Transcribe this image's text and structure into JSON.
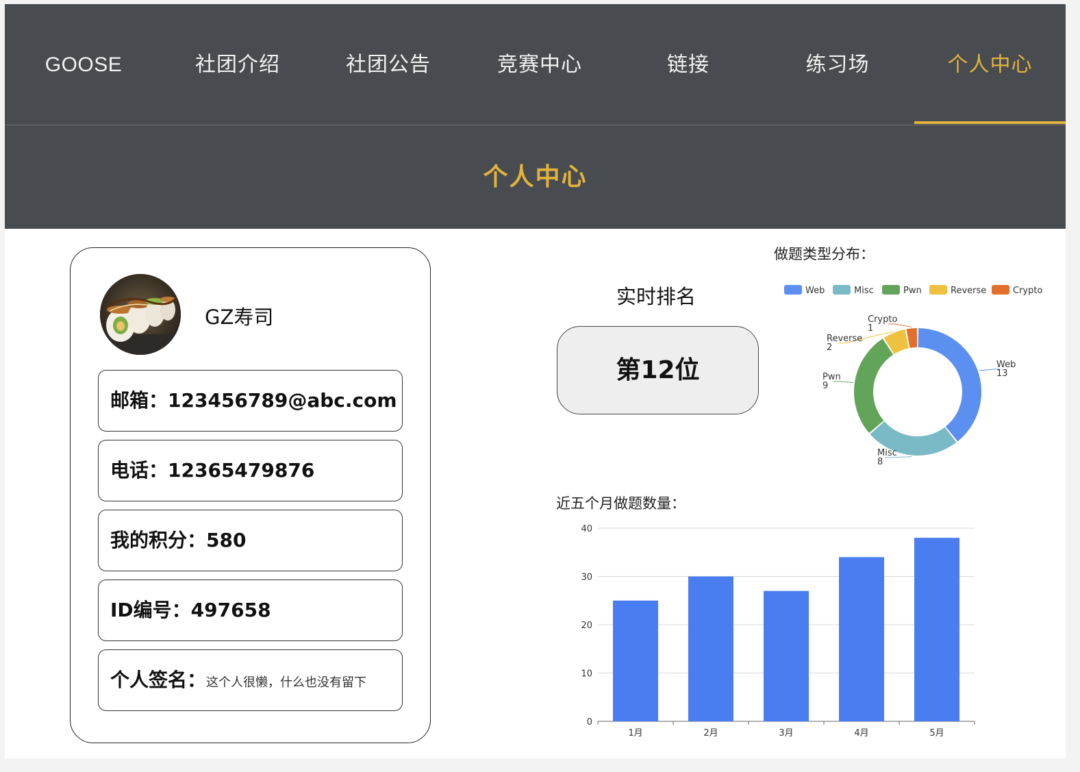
{
  "nav": {
    "items": [
      {
        "label": "GOOSE"
      },
      {
        "label": "社团介绍"
      },
      {
        "label": "社团公告"
      },
      {
        "label": "竞赛中心"
      },
      {
        "label": "链接"
      },
      {
        "label": "练习场"
      },
      {
        "label": "个人中心"
      }
    ],
    "active_index": 6
  },
  "banner": {
    "title": "个人中心"
  },
  "profile": {
    "avatar_icon": "sushi-avatar",
    "username": "GZ寿司",
    "fields": [
      {
        "label": "邮箱：",
        "value": "123456789@abc.com"
      },
      {
        "label": "电话：",
        "value": "12365479876"
      },
      {
        "label": "我的积分：",
        "value": "580"
      },
      {
        "label": "ID编号：",
        "value": "497658"
      },
      {
        "label": "个人签名：",
        "value": "这个人很懒，什么也没有留下"
      }
    ]
  },
  "rank": {
    "title": "实时排名",
    "value": "第12位"
  },
  "colors": {
    "accent": "#e2b33c",
    "nav_bg": "#484b4f",
    "bar": "#4a7ef0"
  },
  "chart_data": [
    {
      "type": "pie",
      "title": "做题类型分布：",
      "legend_position": "top",
      "donut": true,
      "labels": [
        "Web",
        "Misc",
        "Pwn",
        "Reverse",
        "Crypto"
      ],
      "values": [
        13,
        8,
        9,
        2,
        1
      ],
      "colors": [
        "#5b8ff0",
        "#7ab9c6",
        "#62a55a",
        "#eec13e",
        "#e26f2c"
      ]
    },
    {
      "type": "bar",
      "title": "近五个月做题数量：",
      "categories": [
        "1月",
        "2月",
        "3月",
        "4月",
        "5月"
      ],
      "values": [
        25,
        30,
        27,
        34,
        38
      ],
      "ylim": [
        0,
        40
      ],
      "yticks": [
        0,
        10,
        20,
        30,
        40
      ],
      "grid": true
    }
  ]
}
